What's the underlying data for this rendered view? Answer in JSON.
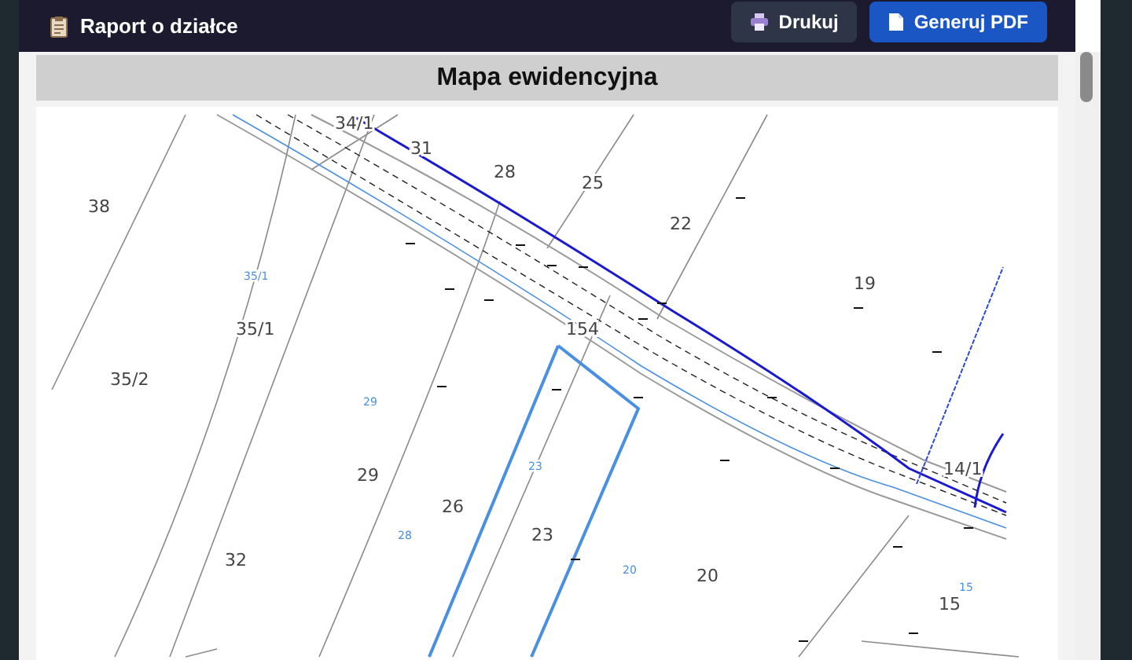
{
  "header": {
    "title": "Raport o działce",
    "buttons": [
      {
        "label": "Drukuj",
        "kind": "print"
      },
      {
        "label": "Generuj PDF",
        "kind": "pdf"
      }
    ]
  },
  "section": {
    "title": "Mapa ewidencyjna"
  },
  "map": {
    "parcels": [
      "34/1",
      "31",
      "28",
      "25",
      "22",
      "38",
      "19",
      "35/1",
      "35/2",
      "154",
      "29",
      "26",
      "23",
      "14/1",
      "32",
      "20",
      "15"
    ],
    "notes": [
      "35/1",
      "29",
      "23",
      "28",
      "20",
      "15"
    ]
  }
}
